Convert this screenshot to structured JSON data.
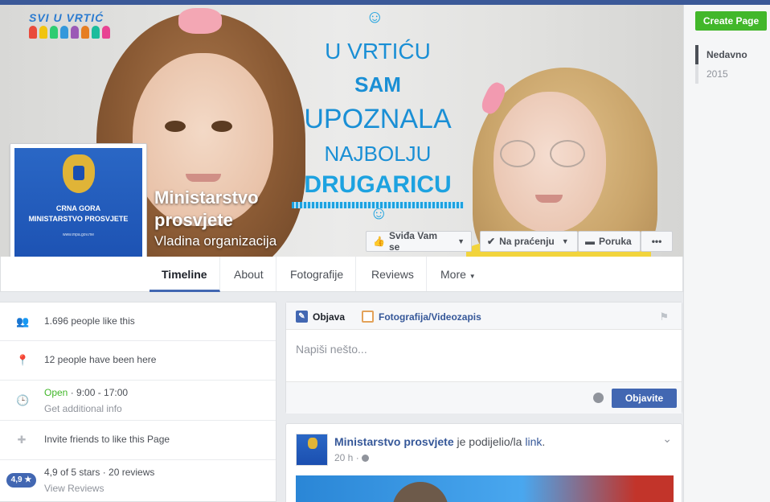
{
  "cover": {
    "logo_text": "SVI U VRTIĆ",
    "text_lines": [
      "U VRTIĆU",
      "SAM",
      "UPOZNALA",
      "NAJBOLJU",
      "DRUGARICU"
    ]
  },
  "page": {
    "name": "Ministarstvo prosvjete",
    "category": "Vladina organizacija",
    "profile_lines": [
      "CRNA GORA",
      "MINISTARSTVO PROSVJETE"
    ],
    "profile_small": "www.mpa.gov.me"
  },
  "actions": {
    "like": "Sviđa Vam se",
    "following": "Na praćenju",
    "message": "Poruka",
    "more": "•••"
  },
  "tabs": [
    "Timeline",
    "About",
    "Fotografije",
    "Reviews",
    "More"
  ],
  "sidebar_right": {
    "create_page": "Create Page",
    "years": [
      "Nedavno",
      "2015"
    ]
  },
  "info": {
    "likes": "1.696 people like this",
    "visits": "12 people have been here",
    "open_label": "Open",
    "hours": " · 9:00 - 17:00",
    "hours_link": "Get additional info",
    "invite": "Invite friends to like this Page",
    "rating_badge": "4,9 ★",
    "rating_text": "4,9 of 5 stars · 20 reviews",
    "view_reviews": "View Reviews"
  },
  "composer": {
    "tab_post": "Objava",
    "tab_photo": "Fotografija/Videozapis",
    "placeholder": "Napiši nešto...",
    "post_button": "Objavite"
  },
  "post": {
    "author": "Ministarstvo prosvjete",
    "action": " je podijelio/la ",
    "object": "link",
    "time": "20 h ·"
  }
}
